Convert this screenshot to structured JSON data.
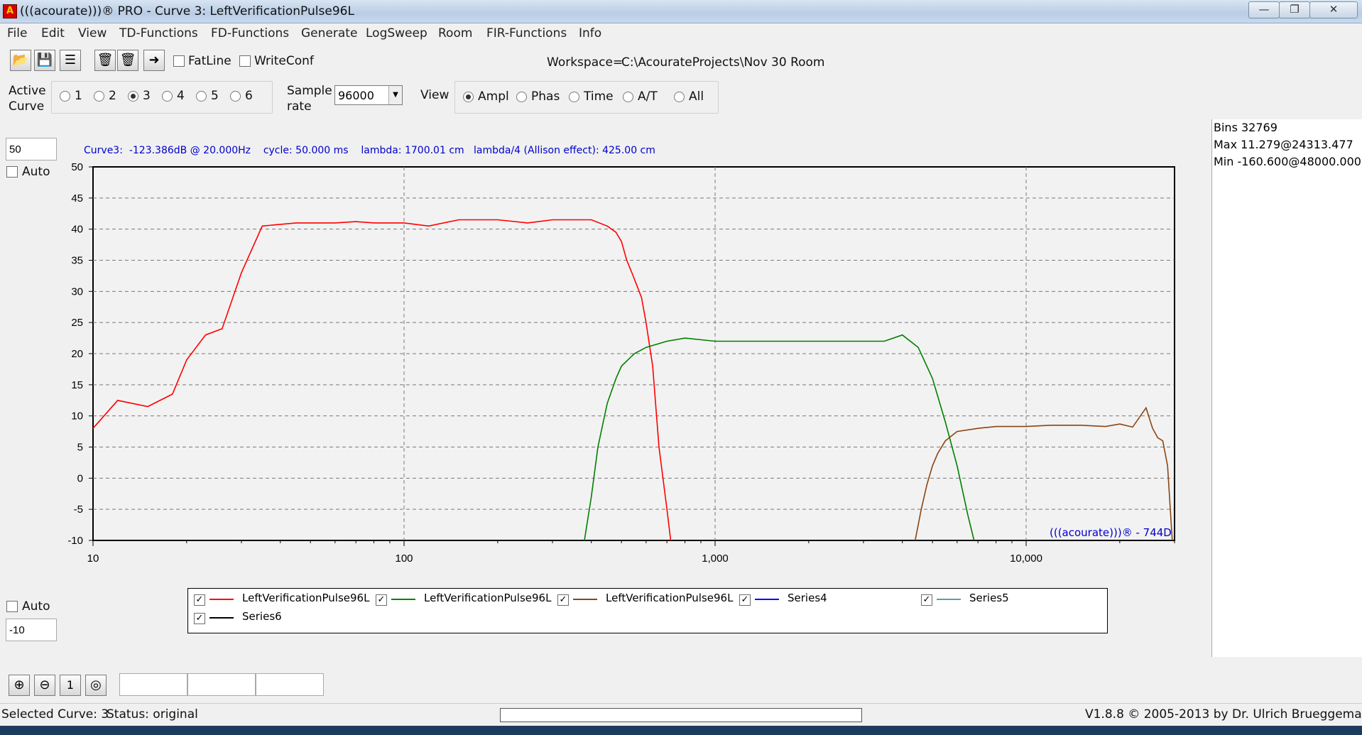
{
  "window": {
    "title": "(((acourate)))® PRO - Curve 3: LeftVerificationPulse96L",
    "controls": [
      "minimize-icon",
      "restore-icon",
      "close-icon"
    ]
  },
  "menu": [
    "File",
    "Edit",
    "View",
    "TD-Functions",
    "FD-Functions",
    "Generate",
    "LogSweep",
    "Room",
    "FIR-Functions",
    "Info"
  ],
  "toolbar": {
    "fatline_label": "FatLine",
    "fatline_checked": false,
    "writeconf_label": "WriteConf",
    "writeconf_checked": false,
    "workspace_label": "Workspace=",
    "workspace_path": "C:\\AcourateProjects\\Nov 30 Room"
  },
  "curve_bar": {
    "active_curve_label_1": "Active",
    "active_curve_label_2": "Curve",
    "curves": [
      "1",
      "2",
      "3",
      "4",
      "5",
      "6"
    ],
    "selected_curve": "3",
    "sample_rate_label_1": "Sample",
    "sample_rate_label_2": "rate",
    "sample_rate_value": "96000",
    "view_label": "View",
    "view_options": [
      "Ampl",
      "Phas",
      "Time",
      "A/T",
      "All"
    ],
    "selected_view": "Ampl"
  },
  "axis_controls": {
    "ymax_value": "50",
    "ymin_value": "-10",
    "auto_top_label": "Auto",
    "auto_bottom_label": "Auto"
  },
  "info_line": "Curve3:  -123.386dB @ 20.000Hz    cycle: 50.000 ms    lambda: 1700.01 cm   lambda/4 (Allison effect): 425.00 cm",
  "watermark": "(((acourate)))® - 744D",
  "right_panel": {
    "bins": "Bins 32769",
    "max": "Max 11.279@24313.477",
    "min": "Min -160.600@48000.000"
  },
  "legend": [
    {
      "name": "LeftVerificationPulse96L",
      "color": "#ff0000",
      "checked": true
    },
    {
      "name": "LeftVerificationPulse96L",
      "color": "#008000",
      "checked": true
    },
    {
      "name": "LeftVerificationPulse96L",
      "color": "#8b4513",
      "checked": true
    },
    {
      "name": "Series4",
      "color": "#0000ff",
      "checked": true
    },
    {
      "name": "Series5",
      "color": "#5f9ea0",
      "checked": true
    },
    {
      "name": "Series6",
      "color": "#000000",
      "checked": true
    }
  ],
  "zoom_buttons": {
    "zoom_in": "zoom-in-icon",
    "zoom_out": "zoom-out-icon",
    "one": "1",
    "target": "target-icon"
  },
  "status": {
    "selected_curve": "Selected Curve: 3",
    "status_text": "Status: original",
    "version": "V1.8.8 © 2005-2013 by Dr. Ulrich Brueggemann"
  },
  "chart_data": {
    "type": "line",
    "x_scale": "log",
    "xlim": [
      10,
      30000
    ],
    "ylim": [
      -10,
      50
    ],
    "x_ticks": [
      "10",
      "100",
      "1,000",
      "10,000"
    ],
    "y_ticks": [
      "50",
      "45",
      "40",
      "35",
      "30",
      "25",
      "20",
      "15",
      "10",
      "5",
      "0",
      "-5",
      "-10"
    ],
    "grid": true,
    "series": [
      {
        "name": "LeftVerificationPulse96L",
        "color": "#ff0000",
        "x": [
          10,
          12,
          15,
          18,
          20,
          23,
          26,
          30,
          35,
          45,
          60,
          70,
          80,
          100,
          120,
          150,
          200,
          250,
          300,
          400,
          450,
          480,
          500,
          520,
          540,
          560,
          580,
          600,
          630,
          660,
          700,
          720
        ],
        "y": [
          8,
          12.5,
          11.5,
          13.5,
          19,
          23,
          24,
          33,
          40.5,
          41,
          41,
          41.2,
          41,
          41,
          40.5,
          41.5,
          41.5,
          41,
          41.5,
          41.5,
          40.5,
          39.5,
          38,
          35,
          33,
          31,
          29,
          25,
          18,
          5,
          -5,
          -10
        ]
      },
      {
        "name": "LeftVerificationPulse96L",
        "color": "#008000",
        "x": [
          380,
          400,
          420,
          450,
          480,
          500,
          550,
          600,
          700,
          800,
          1000,
          1500,
          2000,
          2500,
          3000,
          3500,
          4000,
          4500,
          5000,
          5500,
          6000,
          6500,
          6800
        ],
        "y": [
          -10,
          -3,
          5,
          12,
          16,
          18,
          20,
          21,
          22,
          22.5,
          22,
          22,
          22,
          22,
          22,
          22,
          23,
          21,
          16,
          9,
          2,
          -6,
          -10
        ]
      },
      {
        "name": "LeftVerificationPulse96L",
        "color": "#8b4513",
        "x": [
          4400,
          4600,
          4800,
          5000,
          5200,
          5500,
          6000,
          7000,
          8000,
          10000,
          12000,
          15000,
          18000,
          20000,
          22000,
          24300,
          25500,
          26500,
          27500,
          28500,
          29500
        ],
        "y": [
          -10,
          -5,
          -1,
          2,
          4,
          6,
          7.5,
          8,
          8.3,
          8.3,
          8.5,
          8.5,
          8.3,
          8.7,
          8.2,
          11.3,
          8,
          6.5,
          6,
          2,
          -10
        ]
      }
    ]
  }
}
